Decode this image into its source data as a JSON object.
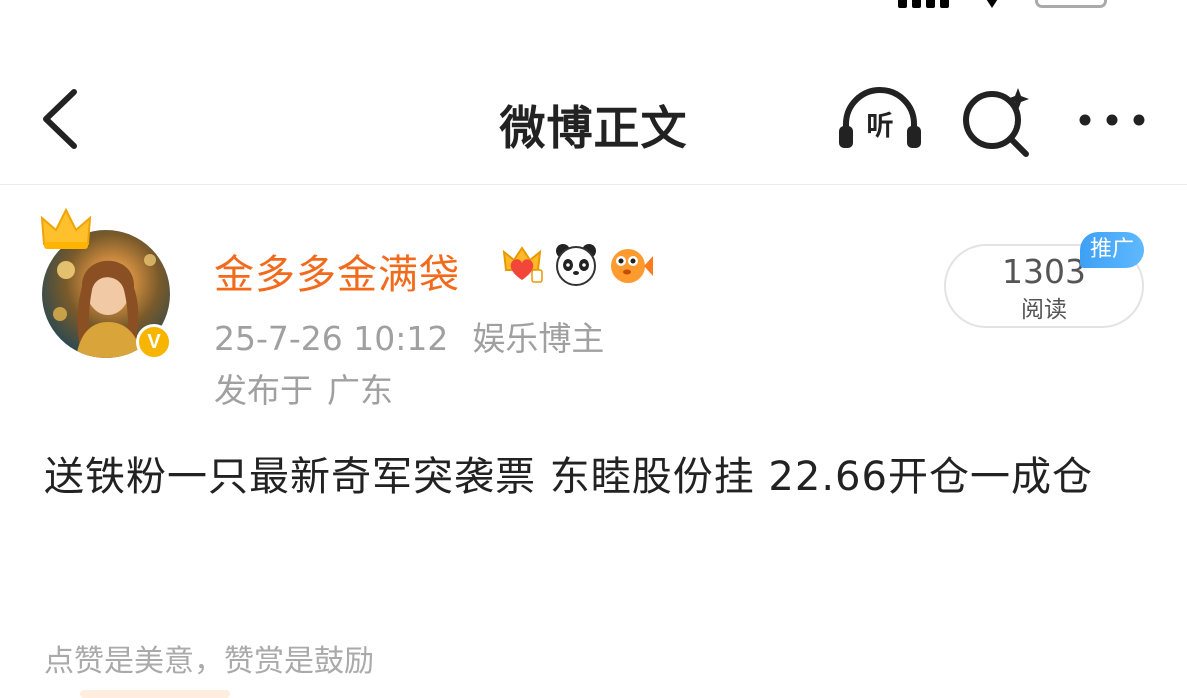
{
  "nav": {
    "title": "微博正文",
    "listen_label": "听"
  },
  "author": {
    "name": "金多多金满袋",
    "verified_mark": "V",
    "badges": [
      "crown-heart-badge-icon",
      "panda-badge-icon",
      "pufferfish-badge-icon"
    ],
    "name_color": "#f26b1d"
  },
  "post": {
    "date": "25-7-26 10:12",
    "category": "娱乐博主",
    "location_prefix": "发布于",
    "location": "广东",
    "content": "送铁粉一只最新奇军突袭票 东睦股份挂 22.66开仓一成仓"
  },
  "stats": {
    "read_count": "1303",
    "read_label": "阅读",
    "promo_tag": "推广"
  },
  "footer": {
    "reward_text": "点赞是美意，赞赏是鼓励"
  },
  "colors": {
    "accent_orange": "#f26b1d",
    "promo_blue": "#3ea0f5",
    "verified_gold": "#f7b500",
    "meta_gray": "#a0a0a0"
  }
}
